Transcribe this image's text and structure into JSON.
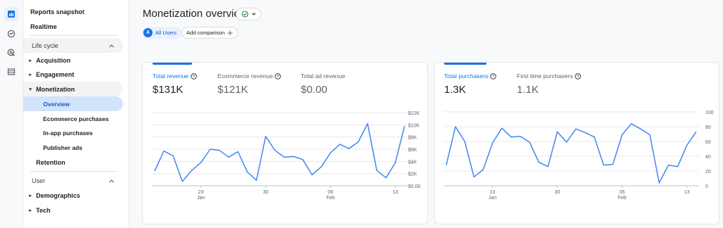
{
  "nav": {
    "reports_snapshot": "Reports snapshot",
    "realtime": "Realtime",
    "lifecycle_section": "Life cycle",
    "acquisition": "Acquisition",
    "engagement": "Engagement",
    "monetization": "Monetization",
    "overview": "Overview",
    "ecommerce_purchases": "Ecommerce purchases",
    "inapp_purchases": "In-app purchases",
    "publisher_ads": "Publisher ads",
    "retention": "Retention",
    "user_section": "User",
    "demographics": "Demographics",
    "tech": "Tech"
  },
  "header": {
    "title": "Monetization overview",
    "all_users_badge": "A",
    "all_users": "All Users",
    "add_comparison": "Add comparison"
  },
  "card_left": {
    "metrics": [
      {
        "label": "Total revenue",
        "value": "$131K"
      },
      {
        "label": "Ecommerce revenue",
        "value": "$121K"
      },
      {
        "label": "Total ad revenue",
        "value": "$0.00"
      }
    ]
  },
  "card_right": {
    "metrics": [
      {
        "label": "Total purchasers",
        "value": "1.3K"
      },
      {
        "label": "First time purchasers",
        "value": "1.1K"
      }
    ]
  },
  "colors": {
    "accent": "#1a73e8",
    "line": "#4285f4"
  },
  "chart_data": [
    {
      "type": "line",
      "ylim": [
        0,
        12000
      ],
      "yticks": [
        "$12K",
        "$10K",
        "$8K",
        "$6K",
        "$4K",
        "$2K",
        "$0.00"
      ],
      "ytick_values": [
        12000,
        10000,
        8000,
        6000,
        4000,
        2000,
        0
      ],
      "xticks": [
        {
          "index": 5,
          "day": "23",
          "month": "Jan"
        },
        {
          "index": 12,
          "day": "30",
          "month": ""
        },
        {
          "index": 19,
          "day": "06",
          "month": "Feb"
        },
        {
          "index": 26,
          "day": "13",
          "month": ""
        }
      ],
      "series": [
        {
          "values": [
            2400,
            5700,
            4900,
            700,
            2500,
            3800,
            6000,
            5800,
            4700,
            5600,
            2300,
            900,
            8100,
            5800,
            4700,
            4800,
            4300,
            1800,
            3100,
            5400,
            6800,
            6100,
            7200,
            10200,
            2500,
            1300,
            3800,
            9800
          ]
        }
      ]
    },
    {
      "type": "line",
      "ylim": [
        0,
        100
      ],
      "yticks": [
        "100",
        "80",
        "60",
        "40",
        "20",
        "0"
      ],
      "ytick_values": [
        100,
        80,
        60,
        40,
        20,
        0
      ],
      "xticks": [
        {
          "index": 5,
          "day": "23",
          "month": "Jan"
        },
        {
          "index": 12,
          "day": "30",
          "month": ""
        },
        {
          "index": 19,
          "day": "06",
          "month": "Feb"
        },
        {
          "index": 26,
          "day": "13",
          "month": ""
        }
      ],
      "series": [
        {
          "values": [
            28,
            80,
            60,
            12,
            22,
            58,
            78,
            66,
            67,
            59,
            32,
            26,
            73,
            59,
            77,
            72,
            66,
            28,
            29,
            69,
            84,
            77,
            69,
            4,
            28,
            26,
            55,
            73
          ]
        }
      ]
    }
  ]
}
